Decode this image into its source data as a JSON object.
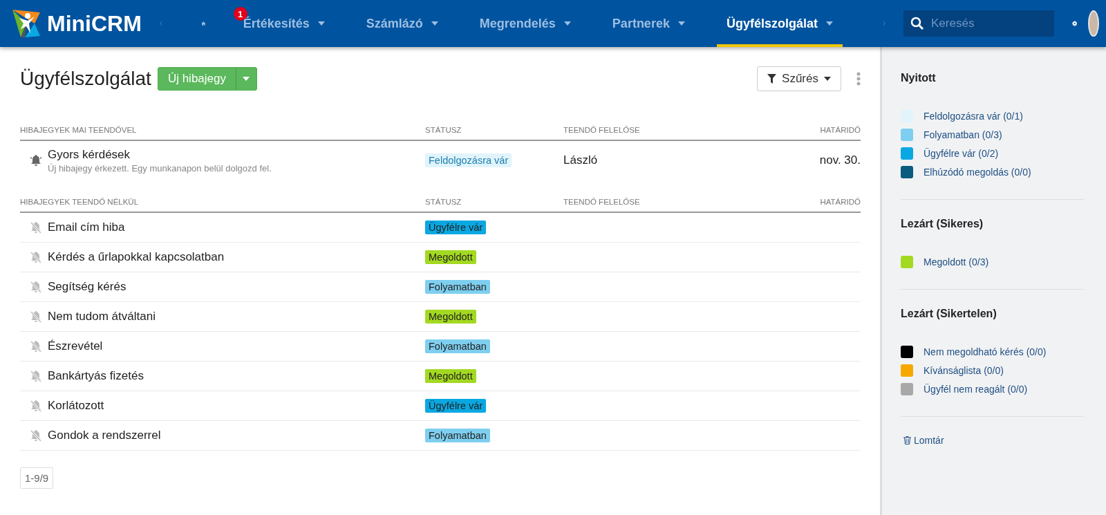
{
  "nav": {
    "brand": "MiniCRM",
    "badge": "1",
    "items": [
      {
        "label": "Értékesítés",
        "selected": false
      },
      {
        "label": "Számlázó",
        "selected": false
      },
      {
        "label": "Megrendelés",
        "selected": false
      },
      {
        "label": "Partnerek",
        "selected": false
      },
      {
        "label": "Ügyfélszolgálat",
        "selected": true
      }
    ],
    "search": {
      "placeholder": "Keresés"
    }
  },
  "page": {
    "title": "Ügyfélszolgálat",
    "new_button": "Új hibajegy",
    "filter_button": "Szűrés"
  },
  "sections": [
    {
      "columns": [
        "HIBAJEGYEK MAI TEENDŐVEL",
        "STÁTUSZ",
        "TEENDŐ FELELŐSE",
        "HATÁRIDŐ"
      ],
      "rows": [
        {
          "alarm": true,
          "title": "Gyors kérdések",
          "note": "Új hibajegy érkezett. Egy munkanapon belül dolgozd fel.",
          "status": "Feldolgozásra vár",
          "color": "#e1f4fc",
          "owner": "László",
          "deadline": "nov. 30."
        }
      ]
    },
    {
      "columns": [
        "HIBAJEGYEK TEENDŐ NÉLKÜL",
        "STÁTUSZ",
        "TEENDŐ FELELŐSE",
        "HATÁRIDŐ"
      ],
      "rows": [
        {
          "alarm": false,
          "title": "Email cím hiba",
          "status": "Ügyfélre vár",
          "color": "#0aa8e2"
        },
        {
          "alarm": false,
          "title": "Kérdés a űrlapokkal kapcsolatban",
          "status": "Megoldott",
          "color": "#a3d921"
        },
        {
          "alarm": false,
          "title": "Segítség kérés",
          "status": "Folyamatban",
          "color": "#7ecfef"
        },
        {
          "alarm": false,
          "title": "Nem tudom átváltani",
          "status": "Megoldott",
          "color": "#a3d921"
        },
        {
          "alarm": false,
          "title": "Észrevétel",
          "status": "Folyamatban",
          "color": "#7ecfef"
        },
        {
          "alarm": false,
          "title": "Bankártyás fizetés",
          "status": "Megoldott",
          "color": "#a3d921"
        },
        {
          "alarm": false,
          "title": "Korlátozott",
          "status": "Ügyfélre vár",
          "color": "#0aa8e2"
        },
        {
          "alarm": false,
          "title": "Gondok a rendszerrel",
          "status": "Folyamatban",
          "color": "#7ecfef"
        }
      ]
    }
  ],
  "pager": "1-9/9",
  "sidebar": {
    "groups": [
      {
        "title": "Nyitott",
        "items": [
          {
            "label": "Feldolgozásra vár (0/1)",
            "color": "#e1f4fc"
          },
          {
            "label": "Folyamatban (0/3)",
            "color": "#7ecfef"
          },
          {
            "label": "Ügyfélre vár (0/2)",
            "color": "#0aa8e2"
          },
          {
            "label": "Elhúzódó megoldás (0/0)",
            "color": "#0b5b80"
          }
        ]
      },
      {
        "title": "Lezárt (Sikeres)",
        "items": [
          {
            "label": "Megoldott (0/3)",
            "color": "#a3d921"
          }
        ]
      },
      {
        "title": "Lezárt (Sikertelen)",
        "items": [
          {
            "label": "Nem megoldható kérés (0/0)",
            "color": "#000000"
          },
          {
            "label": "Kívánságlista (0/0)",
            "color": "#f7a800"
          },
          {
            "label": "Ügyfél nem reagált (0/0)",
            "color": "#a8a8a8"
          }
        ]
      }
    ],
    "trash": "Lomtár"
  }
}
